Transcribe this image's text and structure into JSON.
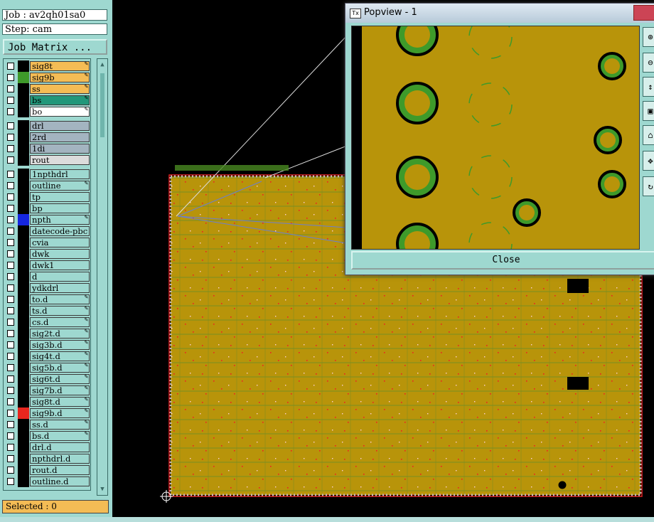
{
  "header": {
    "job": "Job : av2qh01sa0",
    "step": "Step: cam"
  },
  "job_matrix_label": "Job Matrix ...",
  "layers": [
    {
      "name": "sig8t",
      "color": "#f4bc55",
      "sw": "#000",
      "edit": true
    },
    {
      "name": "sig9b",
      "color": "#f4bc55",
      "sw": "#3e9a2a",
      "edit": true
    },
    {
      "name": "ss",
      "color": "#f4bc55",
      "sw": "#000",
      "edit": true
    },
    {
      "name": "bs",
      "color": "#22977a",
      "sw": "#000",
      "edit": true
    },
    {
      "name": "bo",
      "color": "#ffffff",
      "sw": "#000",
      "edit": true
    },
    {
      "name": "drl",
      "color": "#a3b4c0",
      "sw": "#000",
      "edit": false,
      "gap": true
    },
    {
      "name": "2rd",
      "color": "#a3b4c0",
      "sw": "#000",
      "edit": false
    },
    {
      "name": "1di",
      "color": "#a3b4c0",
      "sw": "#000",
      "edit": false
    },
    {
      "name": "rout",
      "color": "#dcdcdc",
      "sw": "#000",
      "edit": false
    },
    {
      "name": "1npthdrl",
      "color": "#9ed8d0",
      "sw": "#000",
      "edit": false,
      "gap": true
    },
    {
      "name": "outline",
      "color": "#9ed8d0",
      "sw": "#000",
      "edit": true
    },
    {
      "name": "tp",
      "color": "#9ed8d0",
      "sw": "#000",
      "edit": false
    },
    {
      "name": "bp",
      "color": "#9ed8d0",
      "sw": "#000",
      "edit": false
    },
    {
      "name": "npth",
      "color": "#9ed8d0",
      "sw": "#1526e0",
      "edit": true,
      "active": true
    },
    {
      "name": "datecode-pbc",
      "color": "#9ed8d0",
      "sw": "#000",
      "edit": false
    },
    {
      "name": "cvia",
      "color": "#9ed8d0",
      "sw": "#000",
      "edit": false
    },
    {
      "name": "dwk",
      "color": "#9ed8d0",
      "sw": "#000",
      "edit": false
    },
    {
      "name": "dwk1",
      "color": "#9ed8d0",
      "sw": "#000",
      "edit": false
    },
    {
      "name": "d",
      "color": "#9ed8d0",
      "sw": "#000",
      "edit": false
    },
    {
      "name": "ydkdrl",
      "color": "#9ed8d0",
      "sw": "#000",
      "edit": false
    },
    {
      "name": "to.d",
      "color": "#9ed8d0",
      "sw": "#000",
      "edit": true
    },
    {
      "name": "ts.d",
      "color": "#9ed8d0",
      "sw": "#000",
      "edit": true
    },
    {
      "name": "cs.d",
      "color": "#9ed8d0",
      "sw": "#000",
      "edit": true
    },
    {
      "name": "sig2t.d",
      "color": "#9ed8d0",
      "sw": "#000",
      "edit": true
    },
    {
      "name": "sig3b.d",
      "color": "#9ed8d0",
      "sw": "#000",
      "edit": true
    },
    {
      "name": "sig4t.d",
      "color": "#9ed8d0",
      "sw": "#000",
      "edit": true
    },
    {
      "name": "sig5b.d",
      "color": "#9ed8d0",
      "sw": "#000",
      "edit": true
    },
    {
      "name": "sig6t.d",
      "color": "#9ed8d0",
      "sw": "#000",
      "edit": true
    },
    {
      "name": "sig7b.d",
      "color": "#9ed8d0",
      "sw": "#000",
      "edit": true
    },
    {
      "name": "sig8t.d",
      "color": "#9ed8d0",
      "sw": "#000",
      "edit": true
    },
    {
      "name": "sig9b.d",
      "color": "#9ed8d0",
      "sw": "#e8261e",
      "edit": true
    },
    {
      "name": "ss.d",
      "color": "#9ed8d0",
      "sw": "#000",
      "edit": true
    },
    {
      "name": "bs.d",
      "color": "#9ed8d0",
      "sw": "#000",
      "edit": true
    },
    {
      "name": "drl.d",
      "color": "#9ed8d0",
      "sw": "#000",
      "edit": false
    },
    {
      "name": "npthdrl.d",
      "color": "#9ed8d0",
      "sw": "#000",
      "edit": false
    },
    {
      "name": "rout.d",
      "color": "#9ed8d0",
      "sw": "#000",
      "edit": false
    },
    {
      "name": "outline.d",
      "color": "#9ed8d0",
      "sw": "#000",
      "edit": false
    }
  ],
  "status": {
    "selected": "Selected : 0"
  },
  "popview": {
    "title": "Popview - 1",
    "close_label": "Close",
    "icon": "Tx"
  },
  "colors": {
    "board": "#b8940a",
    "panel": "#9ed8d0",
    "pad_green": "#3e9a2a",
    "highlight": "#f4bc55"
  }
}
